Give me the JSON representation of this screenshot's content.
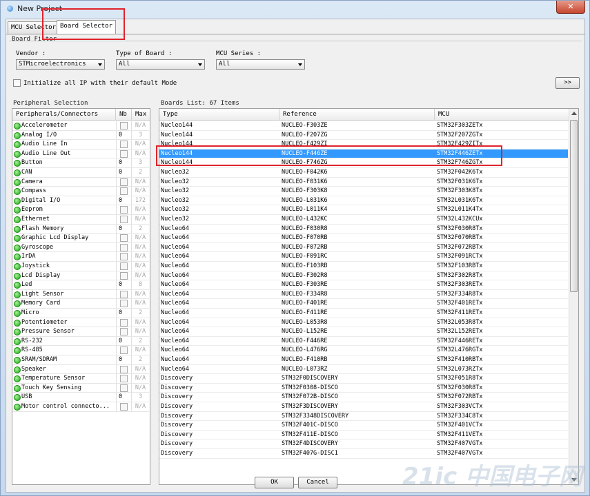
{
  "window": {
    "title": "New Project",
    "close_label": "✕"
  },
  "tabs": [
    {
      "label": "MCU Selector"
    },
    {
      "label": "Board Selector"
    }
  ],
  "board_filter": {
    "title": "Board Filter",
    "vendor_label": "Vendor :",
    "vendor_value": "STMicroelectronics",
    "type_label": "Type of Board :",
    "type_value": "All",
    "series_label": "MCU Series :",
    "series_value": "All",
    "init_all_label": "Initialize all IP with their default Mode",
    "expand_label": ">>"
  },
  "peripherals": {
    "title": "Peripheral Selection",
    "columns": [
      "Peripherals/Connectors",
      "Nb",
      "Max"
    ],
    "rows": [
      {
        "name": "Accelerometer",
        "nb": "",
        "max": "N/A"
      },
      {
        "name": "Analog I/O",
        "nb": "0",
        "max": "3"
      },
      {
        "name": "Audio Line In",
        "nb": "",
        "max": "N/A"
      },
      {
        "name": "Audio Line Out",
        "nb": "",
        "max": "N/A"
      },
      {
        "name": "Button",
        "nb": "0",
        "max": "3"
      },
      {
        "name": "CAN",
        "nb": "0",
        "max": "2"
      },
      {
        "name": "Camera",
        "nb": "",
        "max": "N/A"
      },
      {
        "name": "Compass",
        "nb": "",
        "max": "N/A"
      },
      {
        "name": "Digital I/O",
        "nb": "0",
        "max": "172"
      },
      {
        "name": "Eeprom",
        "nb": "",
        "max": "N/A"
      },
      {
        "name": "Ethernet",
        "nb": "",
        "max": "N/A"
      },
      {
        "name": "Flash Memory",
        "nb": "0",
        "max": "2"
      },
      {
        "name": "Graphic Lcd Display",
        "nb": "",
        "max": "N/A"
      },
      {
        "name": "Gyroscope",
        "nb": "",
        "max": "N/A"
      },
      {
        "name": "IrDA",
        "nb": "",
        "max": "N/A"
      },
      {
        "name": "Joystick",
        "nb": "",
        "max": "N/A"
      },
      {
        "name": "Lcd Display",
        "nb": "",
        "max": "N/A"
      },
      {
        "name": "Led",
        "nb": "0",
        "max": "8"
      },
      {
        "name": "Light Sensor",
        "nb": "",
        "max": "N/A"
      },
      {
        "name": "Memory Card",
        "nb": "",
        "max": "N/A"
      },
      {
        "name": "Micro",
        "nb": "0",
        "max": "2"
      },
      {
        "name": "Potentiometer",
        "nb": "",
        "max": "N/A"
      },
      {
        "name": "Pressure Sensor",
        "nb": "",
        "max": "N/A"
      },
      {
        "name": "RS-232",
        "nb": "0",
        "max": "2"
      },
      {
        "name": "RS-485",
        "nb": "",
        "max": "N/A"
      },
      {
        "name": "SRAM/SDRAM",
        "nb": "0",
        "max": "2"
      },
      {
        "name": "Speaker",
        "nb": "",
        "max": "N/A"
      },
      {
        "name": "Temperature Sensor",
        "nb": "",
        "max": "N/A"
      },
      {
        "name": "Touch Key Sensing",
        "nb": "",
        "max": "N/A"
      },
      {
        "name": "USB",
        "nb": "0",
        "max": "3"
      },
      {
        "name": "Motor control connecto...",
        "nb": "",
        "max": "N/A"
      }
    ]
  },
  "boards": {
    "title": "Boards List: 67 Items",
    "columns": [
      "Type",
      "Reference",
      "MCU"
    ],
    "selected_index": 3,
    "rows": [
      {
        "type": "Nucleo144",
        "ref": "NUCLEO-F303ZE",
        "mcu": "STM32F303ZETx"
      },
      {
        "type": "Nucleo144",
        "ref": "NUCLEO-F207ZG",
        "mcu": "STM32F207ZGTx"
      },
      {
        "type": "Nucleo144",
        "ref": "NUCLEO-F429ZI",
        "mcu": "STM32F429ZITx"
      },
      {
        "type": "Nucleo144",
        "ref": "NUCLEO-F446ZE",
        "mcu": "STM32F446ZETx"
      },
      {
        "type": "Nucleo144",
        "ref": "NUCLEO-F746ZG",
        "mcu": "STM32F746ZGTx"
      },
      {
        "type": "Nucleo32",
        "ref": "NUCLEO-F042K6",
        "mcu": "STM32F042K6Tx"
      },
      {
        "type": "Nucleo32",
        "ref": "NUCLEO-F031K6",
        "mcu": "STM32F031K6Tx"
      },
      {
        "type": "Nucleo32",
        "ref": "NUCLEO-F303K8",
        "mcu": "STM32F303K8Tx"
      },
      {
        "type": "Nucleo32",
        "ref": "NUCLEO-L031K6",
        "mcu": "STM32L031K6Tx"
      },
      {
        "type": "Nucleo32",
        "ref": "NUCLEO-L011K4",
        "mcu": "STM32L011K4Tx"
      },
      {
        "type": "Nucleo32",
        "ref": "NUCLEO-L432KC",
        "mcu": "STM32L432KCUx"
      },
      {
        "type": "Nucleo64",
        "ref": "NUCLEO-F030R8",
        "mcu": "STM32F030R8Tx"
      },
      {
        "type": "Nucleo64",
        "ref": "NUCLEO-F070RB",
        "mcu": "STM32F070RBTx"
      },
      {
        "type": "Nucleo64",
        "ref": "NUCLEO-F072RB",
        "mcu": "STM32F072RBTx"
      },
      {
        "type": "Nucleo64",
        "ref": "NUCLEO-F091RC",
        "mcu": "STM32F091RCTx"
      },
      {
        "type": "Nucleo64",
        "ref": "NUCLEO-F103RB",
        "mcu": "STM32F103RBTx"
      },
      {
        "type": "Nucleo64",
        "ref": "NUCLEO-F302R8",
        "mcu": "STM32F302R8Tx"
      },
      {
        "type": "Nucleo64",
        "ref": "NUCLEO-F303RE",
        "mcu": "STM32F303RETx"
      },
      {
        "type": "Nucleo64",
        "ref": "NUCLEO-F334R8",
        "mcu": "STM32F334R8Tx"
      },
      {
        "type": "Nucleo64",
        "ref": "NUCLEO-F401RE",
        "mcu": "STM32F401RETx"
      },
      {
        "type": "Nucleo64",
        "ref": "NUCLEO-F411RE",
        "mcu": "STM32F411RETx"
      },
      {
        "type": "Nucleo64",
        "ref": "NUCLEO-L053R8",
        "mcu": "STM32L053R8Tx"
      },
      {
        "type": "Nucleo64",
        "ref": "NUCLEO-L152RE",
        "mcu": "STM32L152RETx"
      },
      {
        "type": "Nucleo64",
        "ref": "NUCLEO-F446RE",
        "mcu": "STM32F446RETx"
      },
      {
        "type": "Nucleo64",
        "ref": "NUCLEO-L476RG",
        "mcu": "STM32L476RGTx"
      },
      {
        "type": "Nucleo64",
        "ref": "NUCLEO-F410RB",
        "mcu": "STM32F410RBTx"
      },
      {
        "type": "Nucleo64",
        "ref": "NUCLEO-L073RZ",
        "mcu": "STM32L073RZTx"
      },
      {
        "type": "Discovery",
        "ref": "STM32F0DISCOVERY",
        "mcu": "STM32F051R8Tx"
      },
      {
        "type": "Discovery",
        "ref": "STM32F0308-DISCO",
        "mcu": "STM32F030R8Tx"
      },
      {
        "type": "Discovery",
        "ref": "STM32F072B-DISCO",
        "mcu": "STM32F072RBTx"
      },
      {
        "type": "Discovery",
        "ref": "STM32F3DISCOVERY",
        "mcu": "STM32F303VCTx"
      },
      {
        "type": "Discovery",
        "ref": "STM32F3348DISCOVERY",
        "mcu": "STM32F334C8Tx"
      },
      {
        "type": "Discovery",
        "ref": "STM32F401C-DISCO",
        "mcu": "STM32F401VCTx"
      },
      {
        "type": "Discovery",
        "ref": "STM32F411E-DISCO",
        "mcu": "STM32F411VETx"
      },
      {
        "type": "Discovery",
        "ref": "STM32F4DISCOVERY",
        "mcu": "STM32F407VGTx"
      },
      {
        "type": "Discovery",
        "ref": "STM32F407G-DISC1",
        "mcu": "STM32F407VGTx"
      }
    ]
  },
  "footer": {
    "ok_label": "OK",
    "cancel_label": "Cancel"
  },
  "watermark": "21ic 中国电子网",
  "colors": {
    "selection": "#3399ff",
    "highlight_box": "#e0232b",
    "status_dot": "#1ea814"
  }
}
